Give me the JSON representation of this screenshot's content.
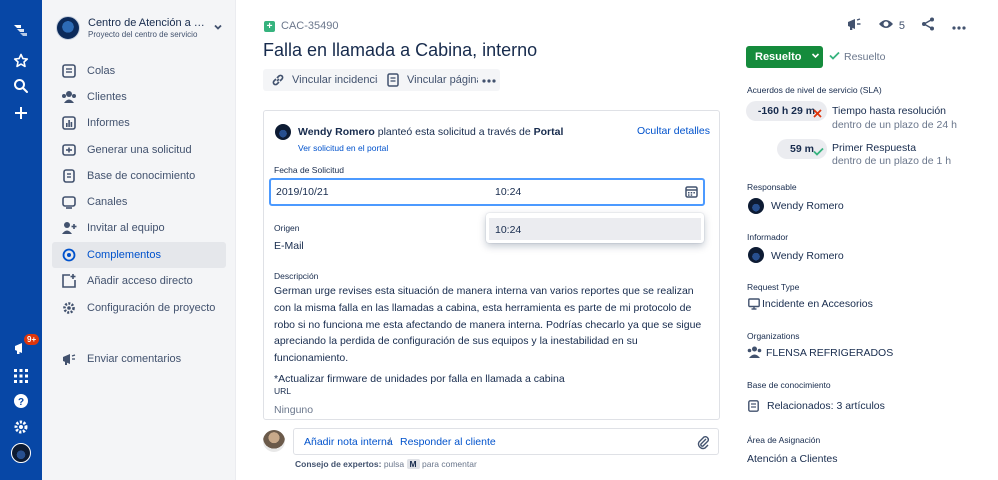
{
  "project": {
    "name": "Centro de Atención a Clie...",
    "subtitle": "Proyecto del centro de servicio"
  },
  "global_nav": {
    "notification_badge": "9+",
    "icons": [
      "jira-logo-icon",
      "star-icon",
      "search-icon",
      "plus-icon",
      "megaphone-icon",
      "app-grid-icon",
      "help-icon",
      "settings-icon",
      "avatar"
    ]
  },
  "sidebar": {
    "items": [
      {
        "label": "Colas",
        "icon": "queue-icon"
      },
      {
        "label": "Clientes",
        "icon": "customers-icon"
      },
      {
        "label": "Informes",
        "icon": "reports-icon"
      },
      {
        "label": "Generar una solicitud",
        "icon": "raise-request-icon"
      },
      {
        "label": "Base de conocimiento",
        "icon": "knowledge-base-icon"
      },
      {
        "label": "Canales",
        "icon": "channels-icon"
      },
      {
        "label": "Invitar al equipo",
        "icon": "invite-icon"
      },
      {
        "label": "Complementos",
        "icon": "addons-icon"
      },
      {
        "label": "Añadir acceso directo",
        "icon": "add-shortcut-icon"
      },
      {
        "label": "Configuración de proyecto",
        "icon": "settings-icon"
      }
    ],
    "active_index": 7,
    "feedback_label": "Enviar comentarios"
  },
  "issue": {
    "key": "CAC-35490",
    "title": "Falla en llamada a Cabina, interno",
    "actions": {
      "link_issue": "Vincular incidencia",
      "link_page": "Vincular página"
    },
    "reporter_line": {
      "name": "Wendy Romero",
      "middle": "planteó esta solicitud a través de",
      "channel": "Portal"
    },
    "view_in_portal": "Ver solicitud en el portal",
    "hide_details": "Ocultar detalles",
    "request_date": {
      "label": "Fecha de Solicitud",
      "date": "2019/10/21",
      "time": "10:24",
      "dropdown_option": "10:24"
    },
    "origin": {
      "label": "Origen",
      "value": "E-Mail"
    },
    "description": {
      "label": "Descripción",
      "text": "German urge revises esta situación de manera interna van varios reportes que se realizan con la misma falla en las llamadas a cabina, esta herramienta es parte de mi protocolo de robo si no funciona me esta afectando de manera interna. Podrías checarlo ya que se sigue apreciando la perdida de configuración de sus equipos y la inestabilidad en su funcionamiento.",
      "note": "*Actualizar firmware de unidades por falla en llamada a cabina"
    },
    "url": {
      "label": "URL",
      "value": "Ninguno"
    }
  },
  "comment": {
    "internal_note": "Añadir nota interna",
    "separator": "/",
    "reply": "Responder al cliente",
    "tip_bold": "Consejo de expertos:",
    "tip_press": "pulsa",
    "tip_key": "M",
    "tip_rest": "para comentar"
  },
  "right": {
    "watchers": "5",
    "status_button": "Resuelto",
    "resolution": "Resuelto",
    "sla_label": "Acuerdos de nivel de servicio (SLA)",
    "sla": [
      {
        "time": "-160 h 29 m",
        "name": "Tiempo hasta resolución",
        "sub": "dentro de un plazo de 24 h",
        "status": "breached"
      },
      {
        "time": "59 m",
        "name": "Primer Respuesta",
        "sub": "dentro de un plazo de 1 h",
        "status": "met"
      }
    ],
    "assignee": {
      "label": "Responsable",
      "value": "Wendy Romero"
    },
    "reporter": {
      "label": "Informador",
      "value": "Wendy Romero"
    },
    "request_type": {
      "label": "Request Type",
      "value": "Incidente en Accesorios"
    },
    "organizations": {
      "label": "Organizations",
      "value": "FLENSA REFRIGERADOS"
    },
    "knowledge": {
      "label": "Base de conocimiento",
      "value": "Relacionados: 3 artículos"
    },
    "area": {
      "label": "Área de Asignación",
      "value": "Atención a Clientes"
    }
  },
  "colors": {
    "global_nav": "#0747A6",
    "link": "#0052CC",
    "resolved_green": "#158B3C",
    "breached_red": "#DE350B",
    "met_green": "#36B37E"
  }
}
